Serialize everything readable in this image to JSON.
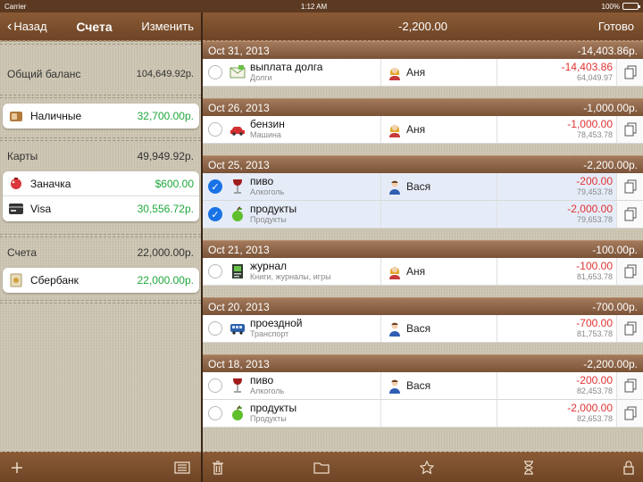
{
  "status": {
    "carrier": "Carrier",
    "time": "1:12 AM",
    "battery": "100%",
    "battery_level": 1.0
  },
  "left": {
    "back_label": "Назад",
    "title": "Счета",
    "edit_label": "Изменить",
    "overall": {
      "label": "Общий баланс",
      "amount": "104,649.92р."
    },
    "cash": {
      "name": "Наличные",
      "value": "32,700.00р."
    },
    "cards": {
      "label": "Карты",
      "total": "49,949.92р.",
      "items": [
        {
          "name": "Заначка",
          "value": "$600.00"
        },
        {
          "name": "Visa",
          "value": "30,556.72р."
        }
      ]
    },
    "accounts": {
      "label": "Счета",
      "total": "22,000.00р.",
      "items": [
        {
          "name": "Сбербанк",
          "value": "22,000.00р."
        }
      ]
    }
  },
  "right": {
    "balance": "-2,200.00",
    "done_label": "Готово",
    "days": [
      {
        "date": "Oct 31, 2013",
        "total": "-14,403.86р.",
        "txns": [
          {
            "icon": "envelope-icon",
            "name": "выплата долга",
            "category": "Долги",
            "person_icon": "female-user-icon",
            "person": "Аня",
            "amount": "-14,403.86",
            "balance": "64,049.97",
            "selected": false
          }
        ]
      },
      {
        "date": "Oct 26, 2013",
        "total": "-1,000.00р.",
        "txns": [
          {
            "icon": "car-icon",
            "name": "бензин",
            "category": "Машина",
            "person_icon": "female-user-icon",
            "person": "Аня",
            "amount": "-1,000.00",
            "balance": "78,453.78",
            "selected": false
          }
        ]
      },
      {
        "date": "Oct 25, 2013",
        "total": "-2,200.00р.",
        "txns": [
          {
            "icon": "wine-glass-icon",
            "name": "пиво",
            "category": "Алкоголь",
            "person_icon": "male-user-icon",
            "person": "Вася",
            "amount": "-200.00",
            "balance": "79,453.78",
            "selected": true
          },
          {
            "icon": "apple-icon",
            "name": "продукты",
            "category": "Продукты",
            "person_icon": "",
            "person": "",
            "amount": "-2,000.00",
            "balance": "79,653.78",
            "selected": true
          }
        ]
      },
      {
        "date": "Oct 21, 2013",
        "total": "-100.00р.",
        "txns": [
          {
            "icon": "journal-icon",
            "name": "журнал",
            "category": "Книги, журналы, игры",
            "person_icon": "female-user-icon",
            "person": "Аня",
            "amount": "-100.00",
            "balance": "81,653.78",
            "selected": false
          }
        ]
      },
      {
        "date": "Oct 20, 2013",
        "total": "-700.00р.",
        "txns": [
          {
            "icon": "bus-icon",
            "name": "проездной",
            "category": "Транспорт",
            "person_icon": "male-user-icon",
            "person": "Вася",
            "amount": "-700.00",
            "balance": "81,753.78",
            "selected": false
          }
        ]
      },
      {
        "date": "Oct 18, 2013",
        "total": "-2,200.00р.",
        "txns": [
          {
            "icon": "wine-glass-icon",
            "name": "пиво",
            "category": "Алкоголь",
            "person_icon": "male-user-icon",
            "person": "Вася",
            "amount": "-200.00",
            "balance": "82,453.78",
            "selected": false
          },
          {
            "icon": "apple-icon",
            "name": "продукты",
            "category": "Продукты",
            "person_icon": "",
            "person": "",
            "amount": "-2,000.00",
            "balance": "82,653.78",
            "selected": false
          }
        ]
      }
    ]
  },
  "toolbar_icons": [
    "plus-icon",
    "list-icon",
    "trash-icon",
    "folder-icon",
    "star-icon",
    "hourglass-icon",
    "lock-icon"
  ]
}
